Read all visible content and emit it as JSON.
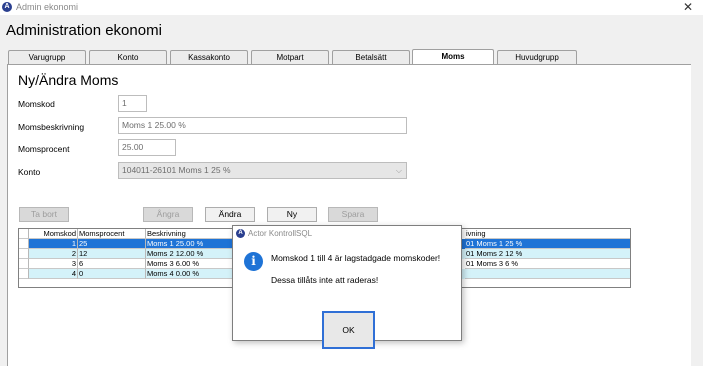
{
  "window": {
    "title": "Admin ekonomi",
    "close_glyph": "✕"
  },
  "app": {
    "header": "Administration ekonomi",
    "app_icon_letter": "A"
  },
  "tabs": [
    {
      "label": "Varugrupp"
    },
    {
      "label": "Konto"
    },
    {
      "label": "Kassakonto"
    },
    {
      "label": "Motpart"
    },
    {
      "label": "Betalsätt"
    },
    {
      "label": "Moms",
      "active": true
    },
    {
      "label": "Huvudgrupp"
    }
  ],
  "form": {
    "title": "Ny/Ändra Moms",
    "momskod": {
      "label": "Momskod",
      "value": "1"
    },
    "beskrivning": {
      "label": "Momsbeskrivning",
      "value": "Moms 1 25.00 %"
    },
    "procent": {
      "label": "Momsprocent",
      "value": "25.00"
    },
    "konto": {
      "label": "Konto",
      "value": "104011-26101 Moms 1 25 %"
    }
  },
  "buttons": {
    "ta_bort": "Ta bort",
    "angra": "Ångra",
    "andra": "Ändra",
    "ny": "Ny",
    "spara": "Spara"
  },
  "grid": {
    "columns": [
      "Momskod",
      "Momsprocent",
      "Beskrivning",
      "ivning"
    ],
    "rows": [
      {
        "kod": "1",
        "procent": "25",
        "beskrivning": "Moms 1 25.00 %",
        "konto": "01 Moms 1 25 %",
        "state": "selected"
      },
      {
        "kod": "2",
        "procent": "12",
        "beskrivning": "Moms 2 12.00 %",
        "konto": "01 Moms 2 12 %",
        "state": "alt"
      },
      {
        "kod": "3",
        "procent": "6",
        "beskrivning": "Moms 3 6.00 %",
        "konto": "01 Moms 3 6 %",
        "state": "plain"
      },
      {
        "kod": "4",
        "procent": "0",
        "beskrivning": "Moms 4 0.00 %",
        "konto": "",
        "state": "alt"
      }
    ]
  },
  "dialog": {
    "title": "Actor KontrollSQL",
    "message1": "Momskod 1 till 4 är lagstadgade momskoder!",
    "message2": "Dessa tillåts inte att raderas!",
    "ok_label": "OK",
    "info_glyph": "i",
    "icon_letter": "A"
  },
  "colors": {
    "selected_row": "#1e73d6",
    "alt_row": "#d4f2f9",
    "ok_focus": "#2f6fd6"
  }
}
